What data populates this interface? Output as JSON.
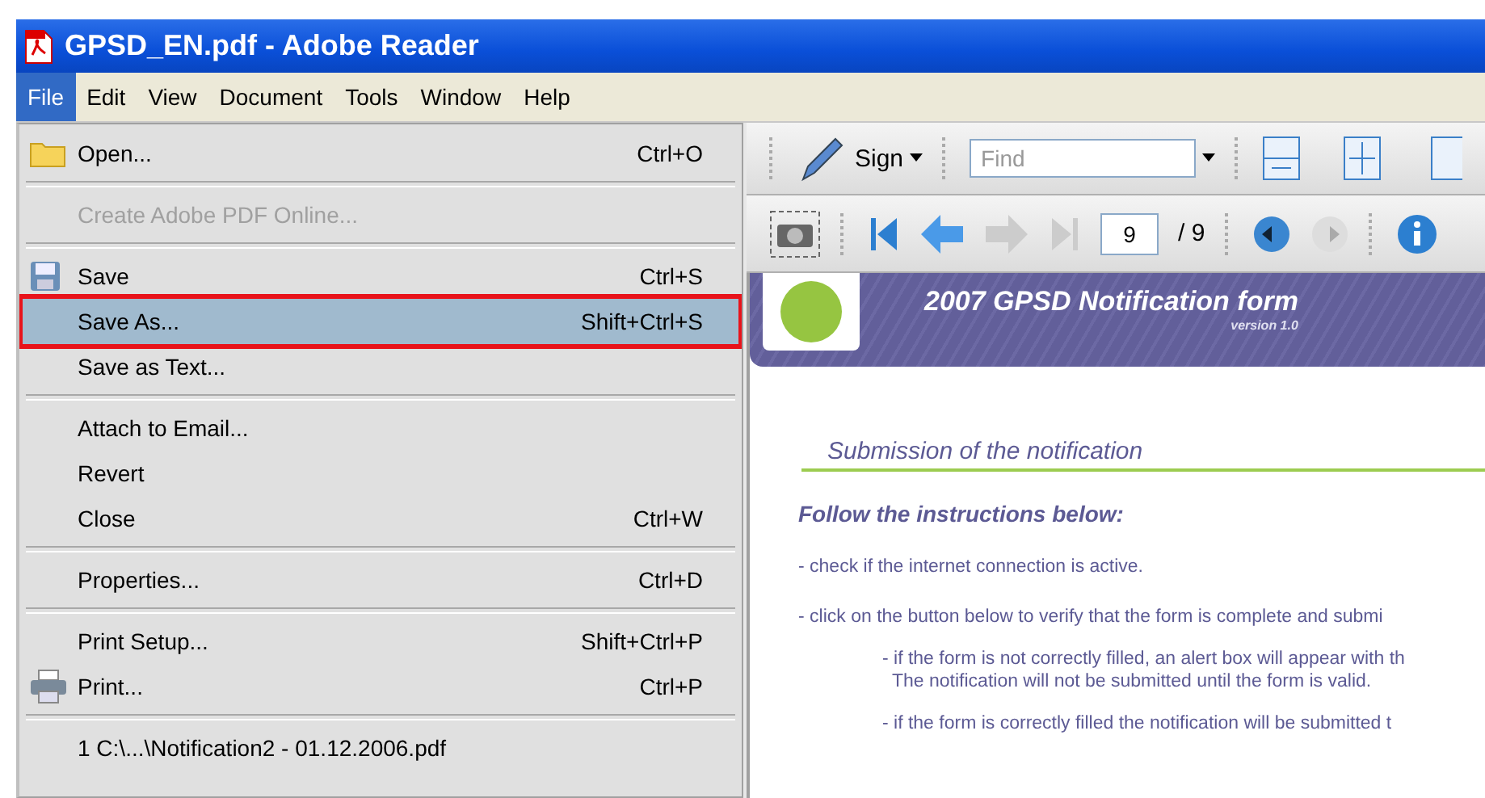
{
  "window": {
    "title": "GPSD_EN.pdf - Adobe Reader"
  },
  "menubar": [
    {
      "label": "File",
      "selected": true
    },
    {
      "label": "Edit",
      "selected": false
    },
    {
      "label": "View",
      "selected": false
    },
    {
      "label": "Document",
      "selected": false
    },
    {
      "label": "Tools",
      "selected": false
    },
    {
      "label": "Window",
      "selected": false
    },
    {
      "label": "Help",
      "selected": false
    }
  ],
  "file_menu": [
    {
      "kind": "folder",
      "label": "Open...",
      "shortcut": "Ctrl+O",
      "disabled": false,
      "selected": false
    },
    {
      "kind": "separator"
    },
    {
      "kind": "plain",
      "label": "Create Adobe PDF Online...",
      "disabled": true,
      "selected": false
    },
    {
      "kind": "separator"
    },
    {
      "kind": "disk",
      "label": "Save",
      "shortcut": "Ctrl+S",
      "disabled": false,
      "selected": false
    },
    {
      "kind": "plain",
      "label": "Save As...",
      "shortcut": "Shift+Ctrl+S",
      "disabled": false,
      "selected": true
    },
    {
      "kind": "plain",
      "label": "Save as Text...",
      "disabled": false,
      "selected": false
    },
    {
      "kind": "separator"
    },
    {
      "kind": "plain",
      "label": "Attach to Email...",
      "disabled": false,
      "selected": false
    },
    {
      "kind": "plain",
      "label": "Revert",
      "disabled": false,
      "selected": false
    },
    {
      "kind": "plain",
      "label": "Close",
      "shortcut": "Ctrl+W",
      "disabled": false,
      "selected": false
    },
    {
      "kind": "separator"
    },
    {
      "kind": "plain",
      "label": "Properties...",
      "shortcut": "Ctrl+D",
      "disabled": false,
      "selected": false
    },
    {
      "kind": "separator"
    },
    {
      "kind": "plain",
      "label": "Print Setup...",
      "shortcut": "Shift+Ctrl+P",
      "disabled": false,
      "selected": false
    },
    {
      "kind": "printer",
      "label": "Print...",
      "shortcut": "Ctrl+P",
      "disabled": false,
      "selected": false
    },
    {
      "kind": "separator"
    },
    {
      "kind": "plain",
      "label": "1 C:\\...\\Notification2 - 01.12.2006.pdf",
      "disabled": false,
      "selected": false
    }
  ],
  "toolbar": {
    "sign": "Sign",
    "find": {
      "placeholder": "Find"
    },
    "page": {
      "value": "9",
      "total": "/ 9"
    }
  },
  "document": {
    "banner_title": "2007 GPSD Notification form",
    "banner_version": "version 1.0",
    "section_title": "Submission of the notification",
    "heading": "Follow the instructions below:",
    "paragraphs": [
      {
        "kind": "bullet",
        "text": "- check if the internet connection is active."
      },
      {
        "kind": "bullet",
        "text": "- click on the button below to verify that the form is complete and submi"
      },
      {
        "kind": "sub",
        "text": "- if the form is not correctly filled, an alert box will appear with th"
      },
      {
        "kind": "subcont",
        "text": "The notification will not be submitted until the form is valid."
      },
      {
        "kind": "sub",
        "text": "- if the form is correctly filled the notification will be submitted t"
      }
    ]
  }
}
